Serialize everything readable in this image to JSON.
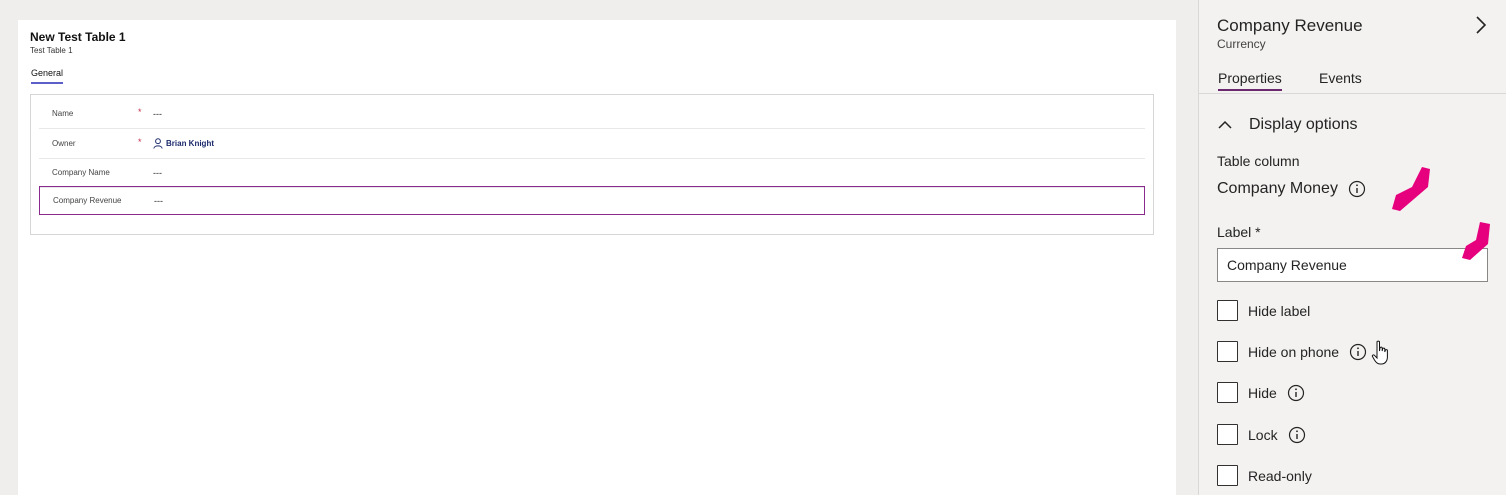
{
  "form": {
    "title": "New Test Table 1",
    "subtitle": "Test Table 1",
    "tab": "General",
    "fields": [
      {
        "label": "Name",
        "required": "*",
        "value": "---"
      },
      {
        "label": "Owner",
        "required": "*",
        "value": "Brian Knight"
      },
      {
        "label": "Company Name",
        "value": "---"
      },
      {
        "label": "Company Revenue",
        "value": "---"
      }
    ]
  },
  "panel": {
    "title": "Company Revenue",
    "subtitle": "Currency",
    "tabs": [
      "Properties",
      "Events"
    ],
    "section": "Display options",
    "table_column_label": "Table column",
    "table_column_value": "Company Money",
    "label_title": "Label *",
    "label_value": "Company Revenue",
    "checkboxes": [
      "Hide label",
      "Hide on phone",
      "Hide",
      "Lock",
      "Read-only"
    ]
  },
  "colors": {
    "accent_tab": "#5b5fc7",
    "selected_border": "#8a2a8f",
    "annotation": "#e6007e"
  }
}
